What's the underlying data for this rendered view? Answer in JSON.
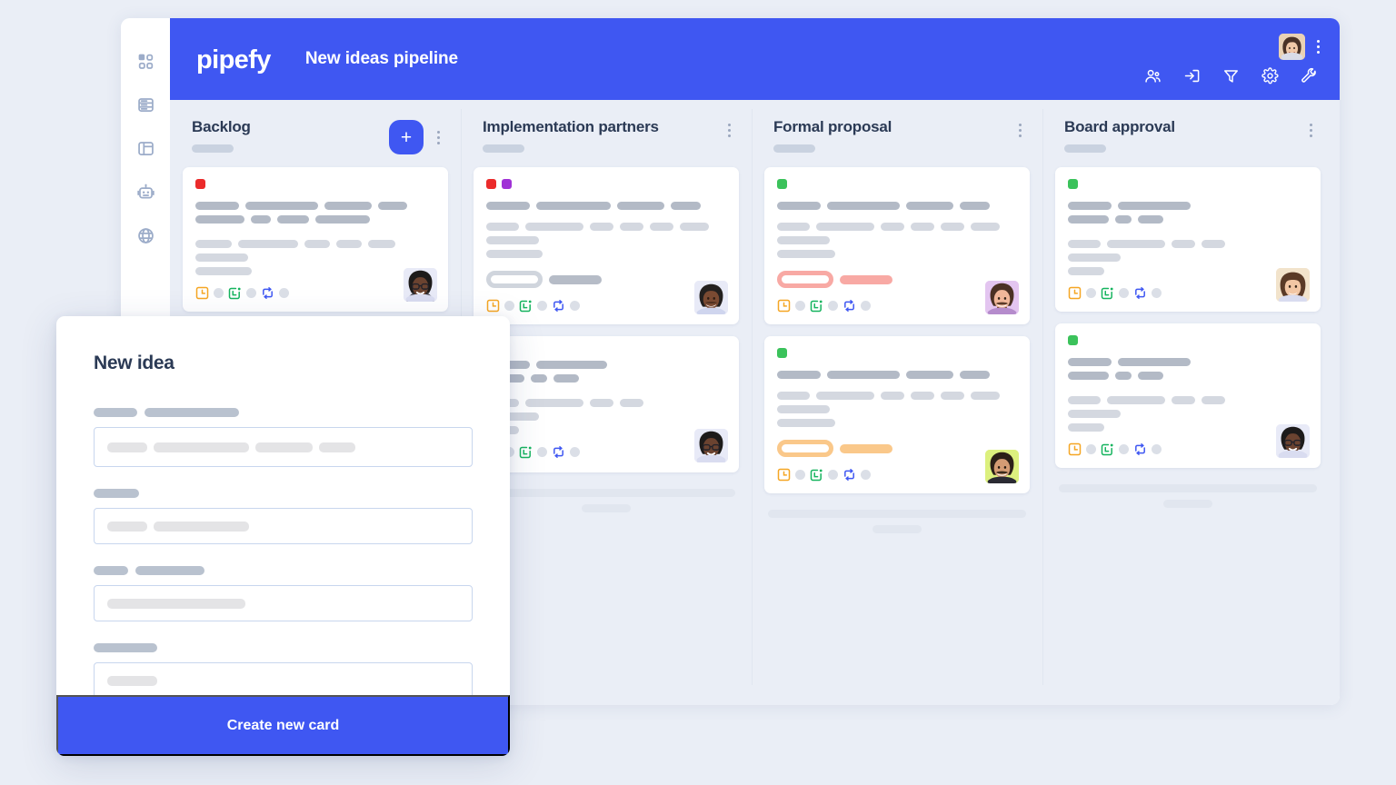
{
  "app": {
    "background_color": "#eaeef6",
    "brand_color": "#3f57f2",
    "logo_text": "pipefy",
    "pipeline_title": "New ideas pipeline"
  },
  "sidebar": {
    "items": [
      {
        "icon": "grid-dashboard-icon",
        "label": "Dashboard"
      },
      {
        "icon": "database-icon",
        "label": "Database"
      },
      {
        "icon": "layout-panel-icon",
        "label": "Portals"
      },
      {
        "icon": "robot-automation-icon",
        "label": "Automations"
      },
      {
        "icon": "globe-icon",
        "label": "Public"
      }
    ]
  },
  "topbar": {
    "avatar": {
      "name": "user-avatar",
      "alt": "User avatar"
    },
    "overflow_menu": "kebab-menu-icon",
    "actions": [
      {
        "icon": "members-icon",
        "label": "Members"
      },
      {
        "icon": "import-inbox-icon",
        "label": "Import"
      },
      {
        "icon": "filter-funnel-icon",
        "label": "Filter"
      },
      {
        "icon": "gear-settings-icon",
        "label": "Settings"
      },
      {
        "icon": "wrench-tools-icon",
        "label": "Tools"
      }
    ]
  },
  "board": {
    "add_card_label": "+",
    "columns": [
      {
        "title": "Backlog",
        "has_add_button": true,
        "cards": [
          {
            "tags": [
              "#eb2b2b"
            ],
            "avatar_bg": "#e8eaf7",
            "badges": [],
            "footer_icons": [
              "clock-orange-icon",
              "calendar-green-icon",
              "flow-blue-icon"
            ]
          }
        ]
      },
      {
        "title": "Implementation partners",
        "has_add_button": false,
        "cards": [
          {
            "tags": [
              "#eb2b2b",
              "#a032d6"
            ],
            "avatar_bg": "#e8eaf7",
            "badges": [
              {
                "color": "#d6dae2",
                "type": "pill"
              },
              {
                "color": "#b6bcc7",
                "type": "bar"
              }
            ],
            "footer_icons": [
              "clock-orange-icon",
              "calendar-green-icon",
              "flow-blue-icon"
            ]
          },
          {
            "tags": [],
            "avatar_bg": "#e8eaf7",
            "badges": [],
            "footer_icons": [
              "calendar-green-icon",
              "flow-blue-icon"
            ]
          }
        ]
      },
      {
        "title": "Formal proposal",
        "has_add_button": false,
        "cards": [
          {
            "tags": [
              "#3bc25b"
            ],
            "avatar_bg": "#e3c5f0",
            "badges": [
              {
                "color": "#f8a9a4",
                "type": "pill"
              },
              {
                "color": "#f8a9a4",
                "type": "bar"
              }
            ],
            "footer_icons": [
              "clock-orange-icon",
              "calendar-green-icon",
              "flow-blue-icon"
            ]
          },
          {
            "tags": [
              "#3bc25b"
            ],
            "avatar_bg": "#dcf07e",
            "badges": [
              {
                "color": "#fac88a",
                "type": "pill"
              },
              {
                "color": "#fac88a",
                "type": "bar"
              }
            ],
            "footer_icons": [
              "clock-orange-icon",
              "calendar-green-icon",
              "flow-blue-icon"
            ]
          }
        ]
      },
      {
        "title": "Board approval",
        "has_add_button": false,
        "cards": [
          {
            "tags": [
              "#3bc25b"
            ],
            "avatar_bg": "#f2e3cb",
            "badges": [],
            "footer_icons": [
              "clock-orange-icon",
              "calendar-green-icon",
              "flow-blue-icon"
            ]
          },
          {
            "tags": [
              "#3bc25b"
            ],
            "avatar_bg": "#e8eaf7",
            "badges": [],
            "footer_icons": [
              "clock-orange-icon",
              "calendar-green-icon",
              "flow-blue-icon"
            ]
          }
        ]
      }
    ]
  },
  "modal": {
    "title": "New idea",
    "submit_label": "Create new card",
    "fields": [
      {
        "label_skeletons": [
          48,
          104
        ],
        "input_skeletons": [
          44,
          105,
          63,
          40
        ]
      },
      {
        "label_skeletons": [
          50
        ],
        "input_skeletons": [
          44,
          105
        ]
      },
      {
        "label_skeletons": [
          38,
          76
        ],
        "input_skeletons": [
          152
        ]
      },
      {
        "label_skeletons": [
          70
        ],
        "input_skeletons": [
          55
        ]
      }
    ]
  }
}
